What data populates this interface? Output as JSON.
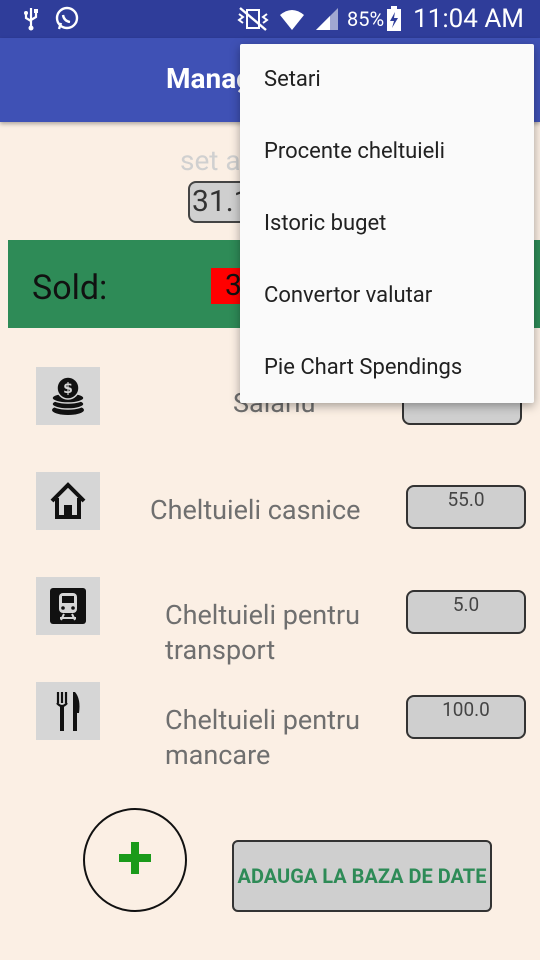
{
  "status_bar": {
    "battery_percent": "85%",
    "time": "11:04 AM",
    "icons": [
      "usb-icon",
      "whatsapp-icon",
      "mute-vibrate-icon",
      "wifi-icon",
      "signal-icon",
      "battery-charging-icon"
    ]
  },
  "app_bar": {
    "title": "Manager"
  },
  "date_section": {
    "label": "set a",
    "value": "31.1"
  },
  "sold": {
    "label": "Sold:",
    "value": "3"
  },
  "categories": [
    {
      "icon": "coins-icon",
      "label": "Salariu",
      "amount": ""
    },
    {
      "icon": "home-icon",
      "label": "Cheltuieli casnice",
      "amount": "55.0"
    },
    {
      "icon": "train-icon",
      "label": "Cheltuieli pentru transport",
      "amount": "5.0"
    },
    {
      "icon": "fork-knife-icon",
      "label": "Cheltuieli pentru mancare",
      "amount": "100.0"
    }
  ],
  "actions": {
    "add_icon": "plus-icon",
    "save_label": "ADAUGA LA BAZA DE DATE"
  },
  "overflow_menu": {
    "items": [
      "Setari",
      "Procente cheltuieli",
      "Istoric buget",
      "Convertor valutar",
      "Pie Chart Spendings"
    ]
  },
  "colors": {
    "status_bar": "#2f3d9a",
    "app_bar": "#3f51b5",
    "background": "#fbefe4",
    "sold_bar": "#2e8b57",
    "sold_value": "#ff0000",
    "fab_plus": "#1a9a1a"
  }
}
